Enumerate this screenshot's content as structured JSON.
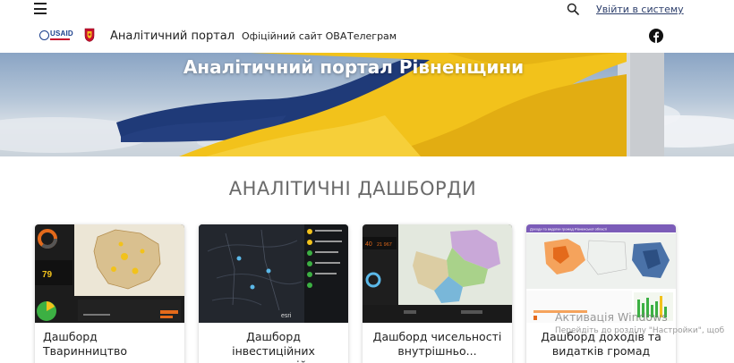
{
  "header": {
    "login_label": "Увійти в систему"
  },
  "nav": {
    "portal_title": "Аналітичний портал",
    "links": [
      "Офіційний сайт ОВА",
      "Телеграм"
    ],
    "usaid_text": "USAID"
  },
  "hero": {
    "title": "Аналітичний портал Рівненщини"
  },
  "section": {
    "heading": "АНАЛІТИЧНІ ДАШБОРДИ"
  },
  "dashboards": [
    {
      "title": "Дашборд Тваринництво"
    },
    {
      "title": "Дашборд інвестиційних пропозицій"
    },
    {
      "title": "Дашборд чисельності внутрішньо..."
    },
    {
      "title": "Дашборд доходів та видатків громад"
    }
  ],
  "thumb_text": {
    "card1_kpi": "79",
    "card3_kpi_a": "40",
    "card3_kpi_b": "21 967",
    "card4_header": "Доходи та видатки громад Рівненської області",
    "card2_brand": "esri"
  },
  "watermark": {
    "title": "Активація Windows",
    "subtitle": "Перейдіть до розділу \"Настройки\", щоб"
  },
  "colors": {
    "link": "#2c3e6b",
    "flag_blue": "#1f3a78",
    "flag_yellow": "#f2c21b",
    "heading_gray": "#6a6a6a"
  }
}
